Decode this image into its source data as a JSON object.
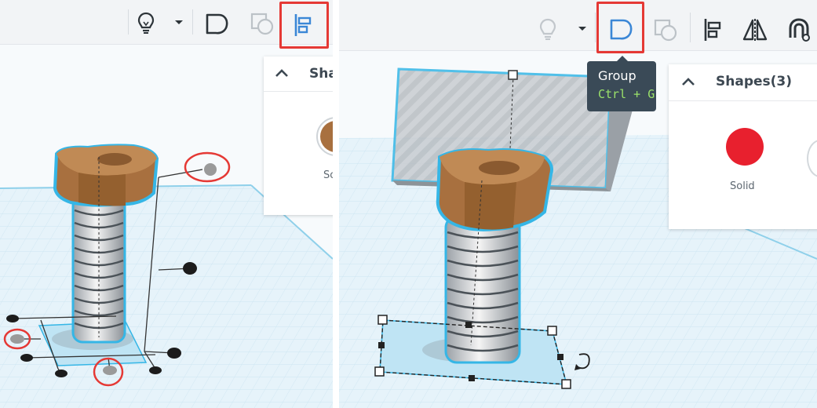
{
  "left": {
    "toolbar": {
      "buttons": [
        {
          "icon": "lightbulb-icon"
        },
        {
          "icon": "chevron-down-icon"
        },
        {
          "icon": "group-icon"
        },
        {
          "icon": "ungroup-icon"
        },
        {
          "icon": "align-icon",
          "highlighted": true
        }
      ]
    },
    "inspector": {
      "title": "Sha",
      "swatch_label": "So",
      "swatch_color": "#a8703f"
    },
    "scene": {
      "shape": "bolt",
      "bolt_color": "#a8703f",
      "selection_color": "#35b6e6",
      "highlighted_handles": 3
    }
  },
  "right": {
    "toolbar": {
      "buttons": [
        {
          "icon": "lightbulb-icon"
        },
        {
          "icon": "chevron-down-icon"
        },
        {
          "icon": "group-icon",
          "highlighted": true
        },
        {
          "icon": "ungroup-icon"
        },
        {
          "icon": "align-icon"
        },
        {
          "icon": "mirror-icon"
        },
        {
          "icon": "magnet-icon"
        }
      ]
    },
    "tooltip": {
      "title": "Group",
      "shortcut": "Ctrl + G"
    },
    "inspector": {
      "title": "Shapes(3)",
      "swatch_label": "Solid",
      "swatch_color": "#e8202e"
    },
    "scene": {
      "shapes": [
        "bolt",
        "hole-box"
      ],
      "bolt_color": "#a8703f",
      "selection_color": "#35b6e6"
    }
  },
  "colors": {
    "highlight": "#e53935",
    "grid": "#e6f3fa",
    "grid_line": "#cfe6f2",
    "toolbar_bg": "#f2f4f6"
  }
}
